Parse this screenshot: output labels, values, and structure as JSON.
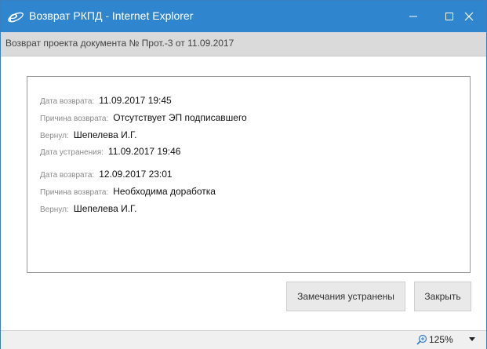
{
  "window": {
    "title": "Возврат РКПД - Internet Explorer",
    "accent_color": "#2f86ce"
  },
  "header": {
    "text": "Возврат проекта документа № Прот.-3 от 11.09.2017"
  },
  "returns": [
    {
      "rows": [
        {
          "label": "Дата возврата:",
          "value": "11.09.2017 19:45"
        },
        {
          "label": "Причина возврата:",
          "value": "Отсутствует ЭП подписавшего"
        },
        {
          "label": "Вернул:",
          "value": "Шепелева И.Г."
        },
        {
          "label": "Дата устранения:",
          "value": "11.09.2017 19:46"
        }
      ]
    },
    {
      "rows": [
        {
          "label": "Дата возврата:",
          "value": "12.09.2017 23:01"
        },
        {
          "label": "Причина возврата:",
          "value": "Необходима доработка"
        },
        {
          "label": "Вернул:",
          "value": "Шепелева И.Г."
        }
      ]
    }
  ],
  "buttons": {
    "fixed_label": "Замечания устранены",
    "close_label": "Закрыть"
  },
  "status": {
    "zoom": "125%"
  },
  "icons": {
    "app": "internet-explorer-icon",
    "minimize": "minimize-icon",
    "maximize": "maximize-icon",
    "close": "close-icon",
    "zoom": "zoom-icon",
    "dropdown": "chevron-down-icon"
  }
}
